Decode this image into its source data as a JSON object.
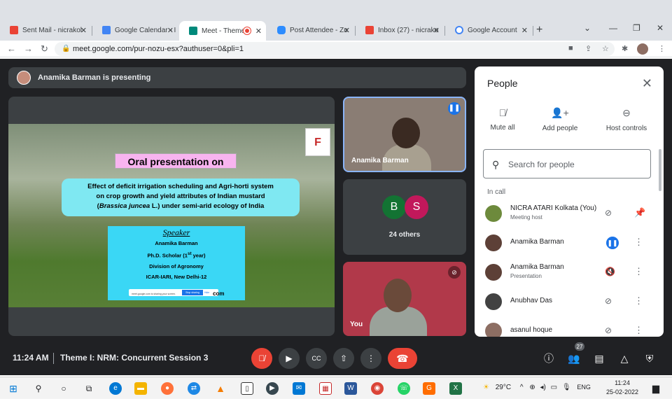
{
  "browser": {
    "tabs": [
      {
        "title": "Sent Mail - nicrakol",
        "icon": "gmail-icon",
        "color": "#ea4335"
      },
      {
        "title": "Google Calendar - I",
        "icon": "calendar-icon",
        "color": "#4285f4"
      },
      {
        "title": "Meet - Theme",
        "icon": "meet-icon",
        "color": "#00897b"
      },
      {
        "title": "Post Attendee - Zo",
        "icon": "zoom-icon",
        "color": "#2d8cff"
      },
      {
        "title": "Inbox (27) - nicrako",
        "icon": "gmail-icon",
        "color": "#ea4335"
      },
      {
        "title": "Google Account",
        "icon": "google-icon",
        "color": "#4285f4"
      }
    ],
    "url": "meet.google.com/pur-nozu-esx?authuser=0&pli=1"
  },
  "meet": {
    "banner": "Anamika Barman is presenting",
    "slide": {
      "title": "Oral presentation on",
      "line1": "Effect of deficit irrigation scheduling and Agri-horti system",
      "line2": "on crop growth and yield attributes of Indian mustard",
      "line3_prefix": "(",
      "line3_species": "Brassica juncea",
      "line3_suffix": " L.) under semi-arid ecology of India",
      "speaker_heading": "Speaker",
      "speaker_name": "Anamika Barman",
      "speaker_role_prefix": "Ph.D. Scholar (1",
      "speaker_role_sup": "st",
      "speaker_role_suffix": " year)",
      "speaker_div": "Division of Agronomy",
      "speaker_inst": "ICAR-IARI, New Delhi-12",
      "share_text": "meet.google.com is sharing your screen.",
      "share_stop": "Stop sharing",
      "share_hide": "Hide",
      "email_suffix": "com"
    },
    "tiles": {
      "presenter": "Anamika Barman",
      "others_initials": [
        "B",
        "S"
      ],
      "others_colors": [
        "#137333",
        "#c2185b"
      ],
      "others_label": "24 others",
      "self": "You"
    },
    "time": "11:24 AM",
    "meeting_title": "Theme I: NRM: Concurrent Session 3",
    "participants_count": "27"
  },
  "people": {
    "title": "People",
    "actions": [
      "Mute all",
      "Add people",
      "Host controls"
    ],
    "search_placeholder": "Search for people",
    "section": "In call",
    "rows": [
      {
        "name": "NICRA ATARI Kolkata (You)",
        "sub": "Meeting host"
      },
      {
        "name": "Anamika Barman",
        "sub": ""
      },
      {
        "name": "Anamika Barman",
        "sub": "Presentation"
      },
      {
        "name": "Anubhav Das",
        "sub": ""
      },
      {
        "name": "asanul hoque",
        "sub": ""
      }
    ]
  },
  "taskbar": {
    "weather": "29°C",
    "lang": "ENG",
    "time": "11:24",
    "date": "25-02-2022"
  }
}
